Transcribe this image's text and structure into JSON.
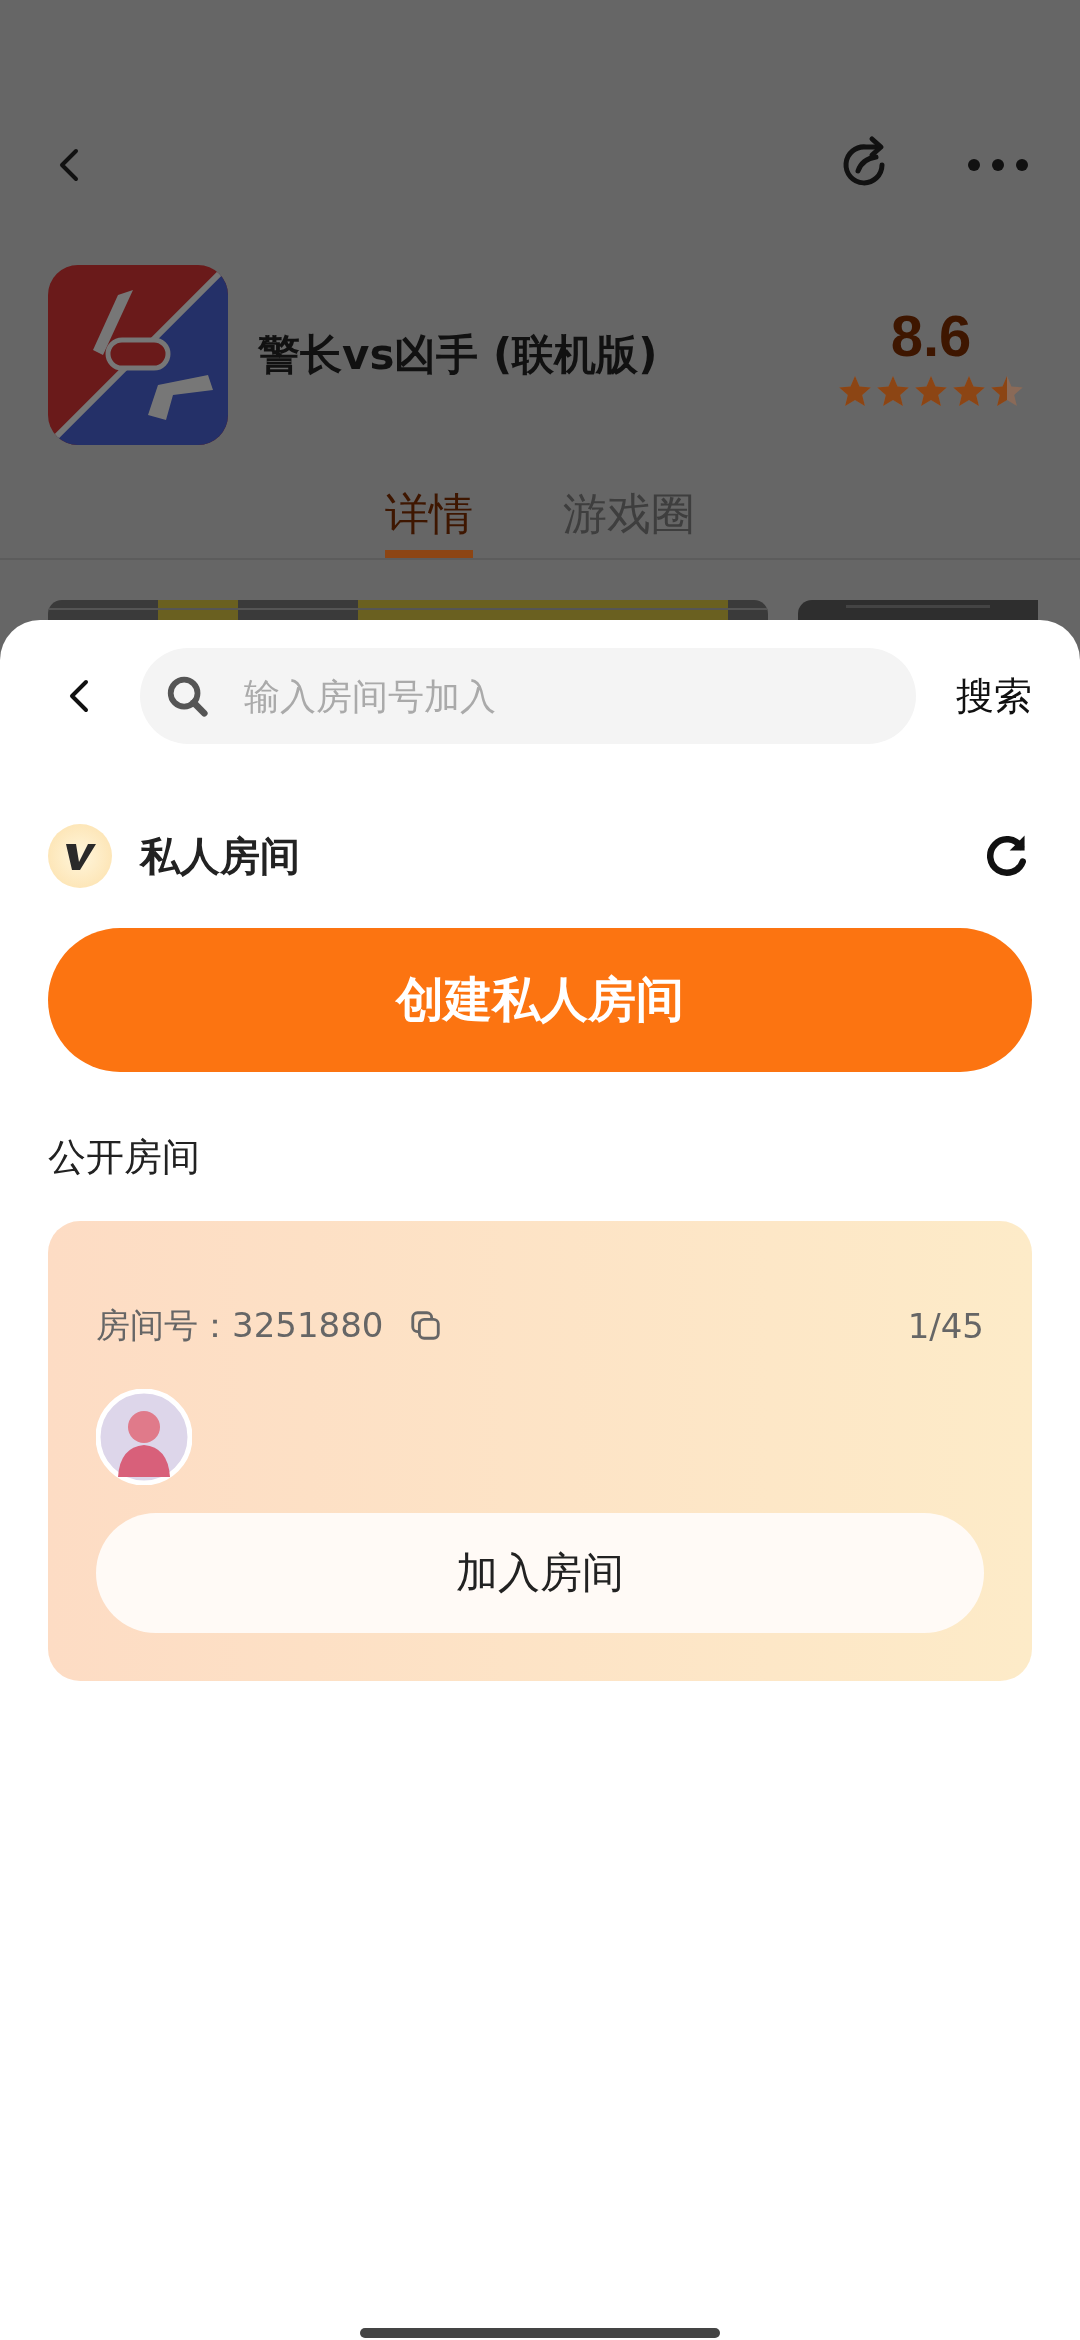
{
  "header": {
    "title": "警长vs凶手 (联机版)",
    "rating": "8.6",
    "stars": 4.5
  },
  "tabs": [
    {
      "label": "详情",
      "selected": true
    },
    {
      "label": "游戏圈",
      "selected": false
    }
  ],
  "sheet": {
    "search": {
      "placeholder": "输入房间号加入"
    },
    "search_button": "搜索",
    "private_section": {
      "title": "私人房间",
      "create_button": "创建私人房间"
    },
    "public_section": {
      "title": "公开房间",
      "rooms": [
        {
          "room_number": "房间号：3251880",
          "occupancy": "1/45",
          "join_button": "加入房间"
        }
      ]
    }
  }
}
